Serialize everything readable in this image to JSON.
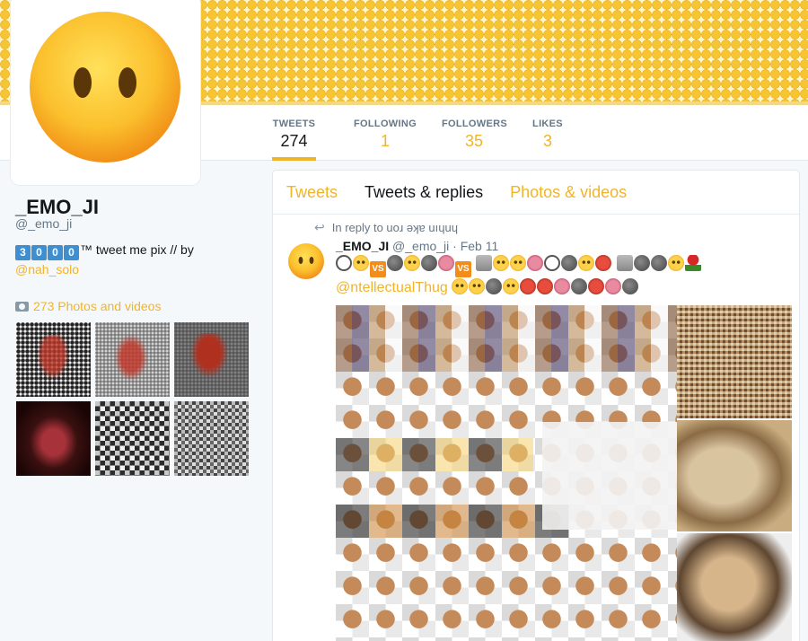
{
  "profile": {
    "name": "_EMO_JI",
    "handle": "@_emo_ji",
    "bio_keycaps": [
      "3",
      "0",
      "0",
      "0"
    ],
    "bio_text": "™ tweet me pix // by",
    "bio_link": "@nah_solo"
  },
  "stats": [
    {
      "label": "TWEETS",
      "value": "274"
    },
    {
      "label": "FOLLOWING",
      "value": "1"
    },
    {
      "label": "FOLLOWERS",
      "value": "35"
    },
    {
      "label": "LIKES",
      "value": "3"
    }
  ],
  "media_section": {
    "label": "273 Photos and videos"
  },
  "timeline": {
    "tabs": [
      "Tweets",
      "Tweets & replies",
      "Photos & videos"
    ],
    "active_tab": "Tweets & replies"
  },
  "tweet": {
    "reply_note": "In reply to uoɹ ǝʞɐ uıɥuɥ",
    "author_name": "_EMO_JI",
    "author_handle": "@_emo_ji",
    "date": "· Feb 11",
    "mention": "@ntellectualThug",
    "vs_label": "VS"
  },
  "colors": {
    "accent": "#f0b429",
    "keycap": "#3d8fd1",
    "text_muted": "#657786"
  },
  "icons": {
    "camera": "camera-icon",
    "reply": "reply-arrow-icon"
  }
}
